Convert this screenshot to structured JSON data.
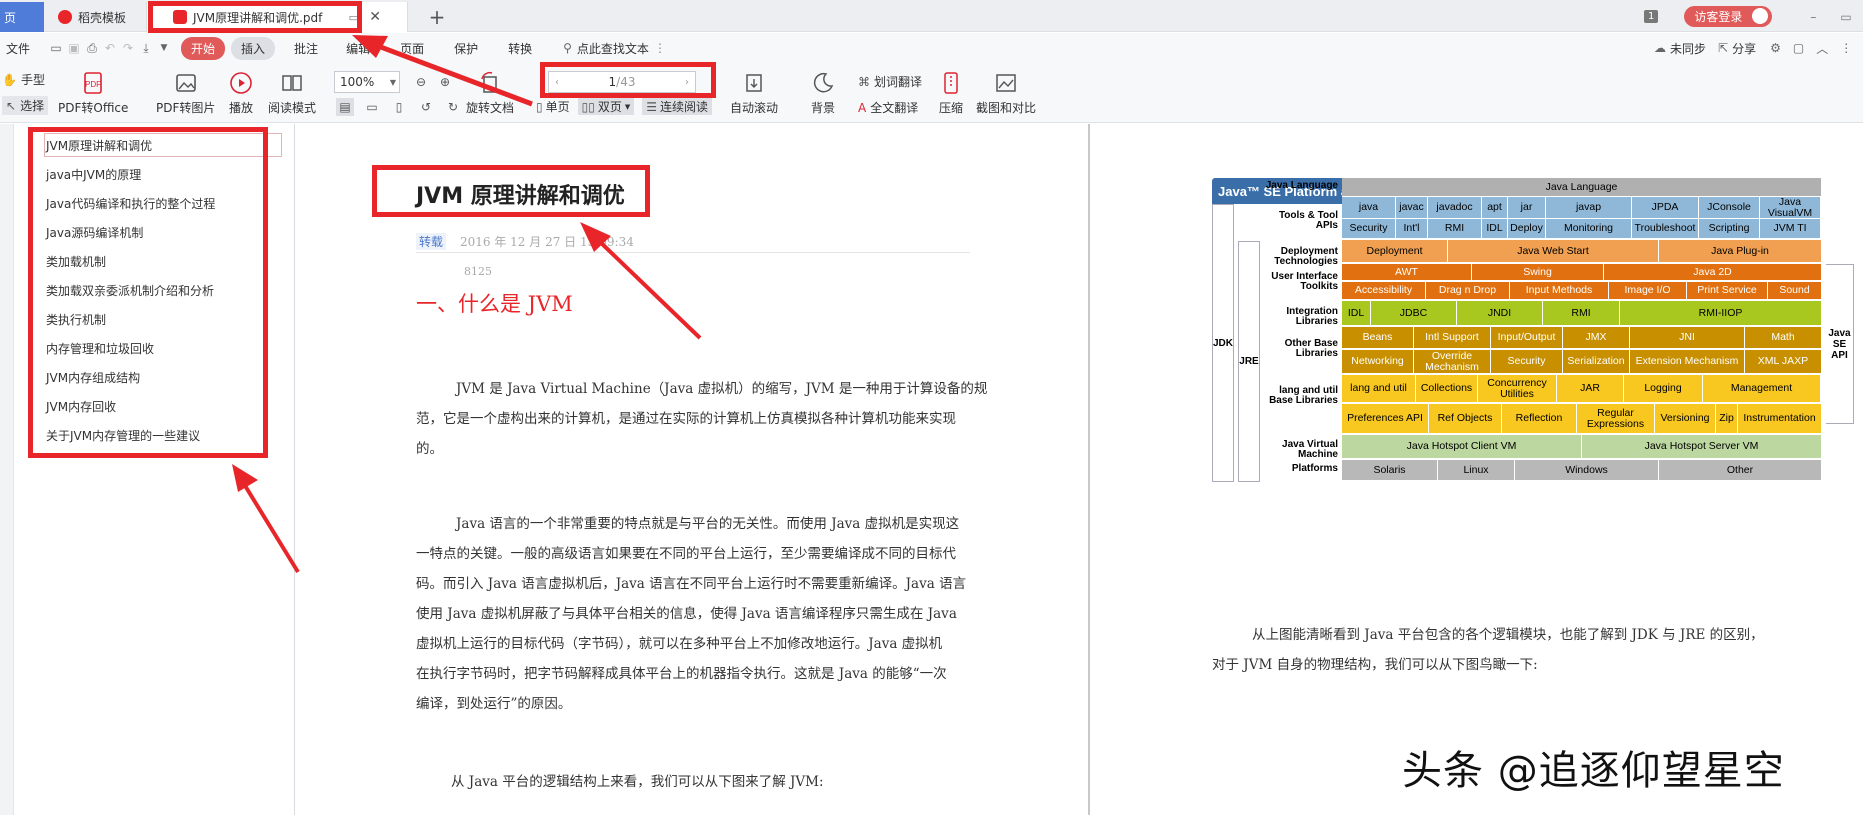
{
  "tabs": {
    "home": "页",
    "template": "稻壳模板",
    "pdf": "JVM原理讲解和调优.pdf",
    "new_tab": "+"
  },
  "titlebar": {
    "badge": "1",
    "login": "访客登录"
  },
  "menubar": {
    "file": "文件",
    "items": [
      "开始",
      "插入",
      "批注",
      "编辑",
      "页面",
      "保护",
      "转换"
    ],
    "search": "点此查找文本",
    "sync": "未同步",
    "share": "分享"
  },
  "ribbon": {
    "hand": "手型",
    "select": "选择",
    "pdf_to_office": "PDF转Office",
    "pdf_to_image": "PDF转图片",
    "play": "播放",
    "read_mode": "阅读模式",
    "zoom": "100%",
    "rotate": "旋转文档",
    "page_current": "1",
    "page_total": "/43",
    "single": "单页",
    "double": "双页",
    "continuous": "连续阅读",
    "auto_scroll": "自动滚动",
    "background": "背景",
    "word_translate": "划词翻译",
    "full_translate": "全文翻译",
    "compress": "压缩",
    "screenshot_compare": "截图和对比"
  },
  "toc": [
    "JVM原理讲解和调优",
    "java中JVM的原理",
    "Java代码编译和执行的整个过程",
    "Java源码编译机制",
    "类加载机制",
    "类加载双亲委派机制介绍和分析",
    "类执行机制",
    "内存管理和垃圾回收",
    "JVM内存组成结构",
    "JVM内存回收",
    "关于JVM内存管理的一些建议"
  ],
  "left_page": {
    "title": "JVM 原理讲解和调优",
    "tag": "转载",
    "date": "2016 年 12 月 27 日 15:09:34",
    "views": "8125",
    "heading": "一、什么是 JVM",
    "p1": [
      "JVM 是 Java Virtual Machine（Java 虚拟机）的缩写，JVM 是一种用于计算设备的规",
      "范，它是一个虚构出来的计算机，是通过在实际的计算机上仿真模拟各种计算机功能来实现",
      "的。"
    ],
    "p2": [
      "Java 语言的一个非常重要的特点就是与平台的无关性。而使用 Java 虚拟机是实现这",
      "一特点的关键。一般的高级语言如果要在不同的平台上运行，至少需要编译成不同的目标代",
      "码。而引入 Java 语言虚拟机后，Java 语言在不同平台上运行时不需要重新编译。Java 语言",
      "使用 Java 虚拟机屏蔽了与具体平台相关的信息，使得 Java 语言编译程序只需生成在 Java",
      "虚拟机上运行的目标代码（字节码），就可以在多种平台上不加修改地运行。Java 虚拟机",
      "在执行字节码时，把字节码解释成具体平台上的机器指令执行。这就是 Java 的能够“一次",
      "编译，到处运行”的原因。"
    ],
    "p3": "从 Java 平台的逻辑结构上来看，我们可以从下图来了解 JVM:"
  },
  "right_page": {
    "p1": "从上图能清晰看到 Java 平台包含的各个逻辑模块，也能了解到 JDK 与 JRE 的区别，",
    "p2": "对于 JVM 自身的物理结构，我们可以从下图鸟瞰一下:",
    "watermark": "头条 @追逐仰望星空"
  },
  "diagram": {
    "title": "Java™ SE Platform at a Glance",
    "jdk": "JDK",
    "jre": "JRE",
    "api": "Java SE API",
    "row_labels": [
      "Java Language",
      "Tools & Tool APIs",
      "Deployment Technologies",
      "User Interface Toolkits",
      "Integration Libraries",
      "Other Base Libraries",
      "lang and util Base Libraries",
      "Java Virtual Machine",
      "Platforms"
    ],
    "java_language": "Java Language",
    "tools_top": [
      "java",
      "javac",
      "javadoc",
      "apt",
      "jar",
      "javap",
      "JPDA",
      "JConsole",
      "Java VisualVM"
    ],
    "tools_bottom": [
      "Security",
      "Int'l",
      "RMI",
      "IDL",
      "Deploy",
      "Monitoring",
      "Troubleshoot",
      "Scripting",
      "JVM TI"
    ],
    "deployment": [
      "Deployment",
      "Java Web Start",
      "Java Plug-in"
    ],
    "ui_top": [
      "AWT",
      "Swing",
      "Java 2D"
    ],
    "ui_bottom": [
      "Accessibility",
      "Drag n Drop",
      "Input Methods",
      "Image I/O",
      "Print Service",
      "Sound"
    ],
    "integration": [
      "IDL",
      "JDBC",
      "JNDI",
      "RMI",
      "RMI-IIOP"
    ],
    "other_top": [
      "Beans",
      "Intl Support",
      "Input/Output",
      "JMX",
      "JNI",
      "Math"
    ],
    "other_bottom": [
      "Networking",
      "Override Mechanism",
      "Security",
      "Serialization",
      "Extension Mechanism",
      "XML JAXP"
    ],
    "lang_top": [
      "lang and util",
      "Collections",
      "Concurrency Utilities",
      "JAR",
      "Logging",
      "Management"
    ],
    "lang_bottom": [
      "Preferences API",
      "Ref Objects",
      "Reflection",
      "Regular Expressions",
      "Versioning",
      "Zip",
      "Instrumentation"
    ],
    "jvm": [
      "Java Hotspot Client VM",
      "Java Hotspot Server VM"
    ],
    "platforms": [
      "Solaris",
      "Linux",
      "Windows",
      "Other"
    ]
  },
  "colors": {
    "accent_red": "#e8262a",
    "toolbar_bg": "#f7f8fa",
    "java_lang": "#b0b0b0",
    "tools": "#8fb8d8",
    "deployment": "#f0a050",
    "ui": "#e07010",
    "integration": "#a8c820",
    "other_base": "#c89000",
    "lang_util": "#f8c820",
    "jvm": "#bcd8a0",
    "platforms": "#b8b8b8"
  }
}
